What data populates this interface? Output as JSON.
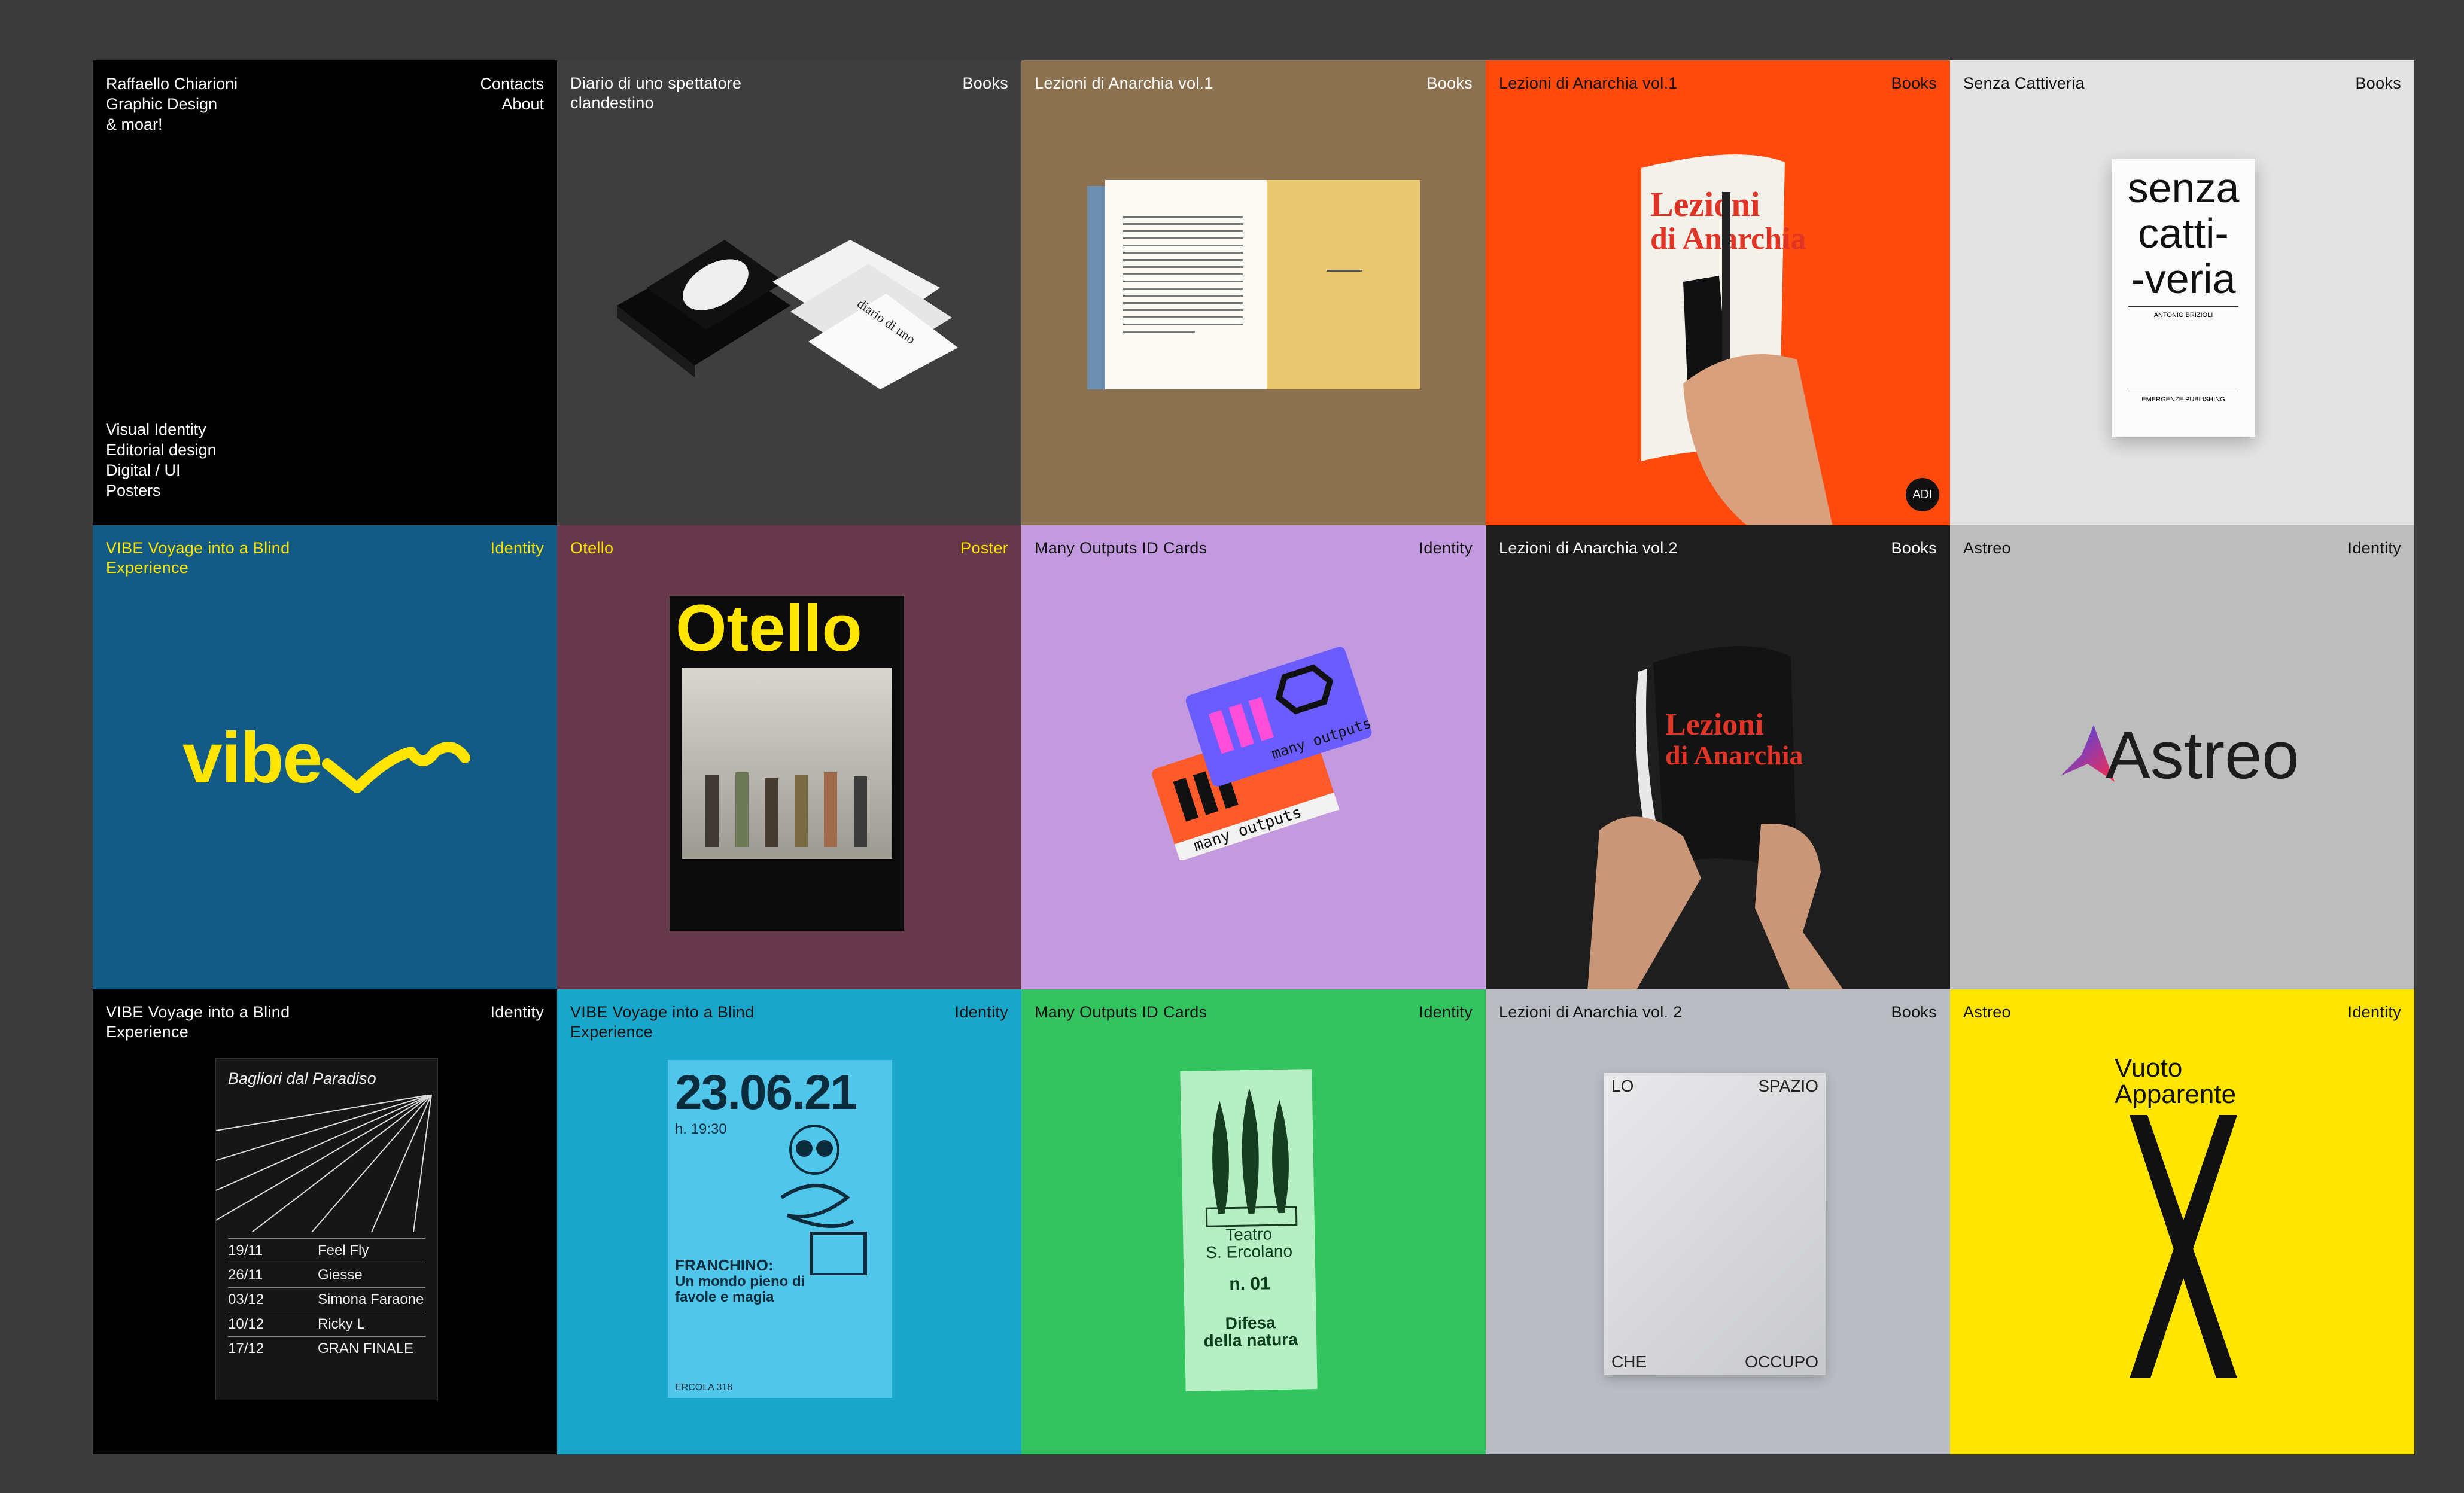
{
  "intro": {
    "name_lines": [
      "Raffaello Chiarioni",
      "Graphic Design",
      "& moar!"
    ],
    "links": [
      "Contacts",
      "About"
    ],
    "menu": [
      "Visual Identity",
      "Editorial design",
      "Digital / UI",
      "Posters"
    ]
  },
  "tiles": [
    {
      "title": "Diario di uno spettatore clandestino",
      "category": "Books",
      "bg": "#3e3e3e",
      "fg": "#ffffff"
    },
    {
      "title": "Lezioni di Anarchia vol.1",
      "category": "Books",
      "bg": "#8b7150",
      "fg": "#ffffff"
    },
    {
      "title": "Lezioni di Anarchia vol.1",
      "category": "Books",
      "bg": "#ff4a0e",
      "fg": "#111111"
    },
    {
      "title": "Senza Cattiveria",
      "category": "Books",
      "bg": "#e4e4e4",
      "fg": "#111111"
    },
    {
      "title": "VIBE Voyage into a Blind Experience",
      "category": "Identity",
      "bg": "#135a84",
      "fg": "#ffe500"
    },
    {
      "title": "Otello",
      "category": "Poster",
      "bg": "#66394a",
      "fg": "#ffe500"
    },
    {
      "title": "Many Outputs ID Cards",
      "category": "Identity",
      "bg": "#c39ae0",
      "fg": "#111111"
    },
    {
      "title": "Lezioni di Anarchia vol.2",
      "category": "Books",
      "bg": "#1e1e1e",
      "fg": "#ffffff"
    },
    {
      "title": "Astreo",
      "category": "Identity",
      "bg": "#bdbdbd",
      "fg": "#111111"
    },
    {
      "title": "VIBE Voyage into a Blind Experience",
      "category": "Identity",
      "bg": "#000000",
      "fg": "#ffffff"
    },
    {
      "title": "VIBE Voyage into a Blind Experience",
      "category": "Identity",
      "bg": "#18a6cb",
      "fg": "#111111"
    },
    {
      "title": "Many Outputs ID Cards",
      "category": "Identity",
      "bg": "#33c45f",
      "fg": "#111111"
    },
    {
      "title": "Lezioni di Anarchia vol. 2",
      "category": "Books",
      "bg": "#b9bcc2",
      "fg": "#111111"
    },
    {
      "title": "Astreo",
      "category": "Identity",
      "bg": "#ffe500",
      "fg": "#111111"
    }
  ],
  "art": {
    "senza": [
      "senza",
      "catti-",
      "-veria"
    ],
    "senza_small": [
      "ANTONIO BRIZIOLI",
      "EMERGENZE PUBLISHING"
    ],
    "lezioni_cover": [
      "Lezioni",
      "di Anarchia"
    ],
    "adi": "ADI",
    "vibe": "vibe",
    "otello": "Otello",
    "many_outputs": "many outputs",
    "astreo": "Astreo",
    "bagliori": {
      "title": "Bagliori dal Paradiso",
      "rows": [
        [
          "19/11",
          "Feel Fly"
        ],
        [
          "26/11",
          "Giesse"
        ],
        [
          "03/12",
          "Simona Faraone"
        ],
        [
          "10/12",
          "Ricky L"
        ],
        [
          "17/12",
          "GRAN FINALE"
        ]
      ]
    },
    "franchino": {
      "date": "23.06.21",
      "time": "h. 19:30",
      "title": "FRANCHINO:",
      "subtitle": "Un mondo pieno di favole e magia",
      "footer": "ERCOLA 318"
    },
    "teatro": {
      "line1": "Teatro",
      "line2": "S. Ercolano",
      "line3": "n. 01",
      "line4": "Difesa",
      "line5": "della natura"
    },
    "lo_spazio": [
      "LO",
      "SPAZIO",
      "CHE",
      "OCCUPO"
    ],
    "vuoto": [
      "Vuoto",
      "Apparente"
    ]
  }
}
